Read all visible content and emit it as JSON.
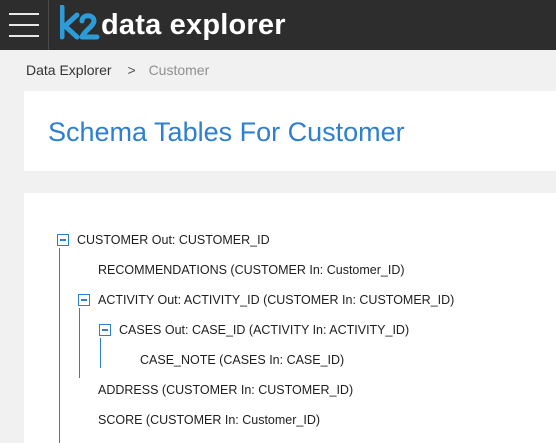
{
  "app": {
    "logo_k2": "k2",
    "logo_text": "data explorer"
  },
  "breadcrumb": {
    "root": "Data Explorer",
    "separator": ">",
    "current": "Customer"
  },
  "page": {
    "title": "Schema Tables For Customer"
  },
  "tree": {
    "customer": "CUSTOMER Out: CUSTOMER_ID",
    "recommendations": "RECOMMENDATIONS (CUSTOMER In: Customer_ID)",
    "activity": "ACTIVITY Out: ACTIVITY_ID (CUSTOMER In: CUSTOMER_ID)",
    "cases": "CASES Out: CASE_ID (ACTIVITY In: ACTIVITY_ID)",
    "case_note": "CASE_NOTE (CASES In: CASE_ID)",
    "address": "ADDRESS (CUSTOMER In: CUSTOMER_ID)",
    "score": "SCORE (CUSTOMER In: Customer_ID)"
  },
  "colors": {
    "accent": "#2d7fd1",
    "topbar": "#2d2d2d",
    "background": "#f1f1f1"
  }
}
